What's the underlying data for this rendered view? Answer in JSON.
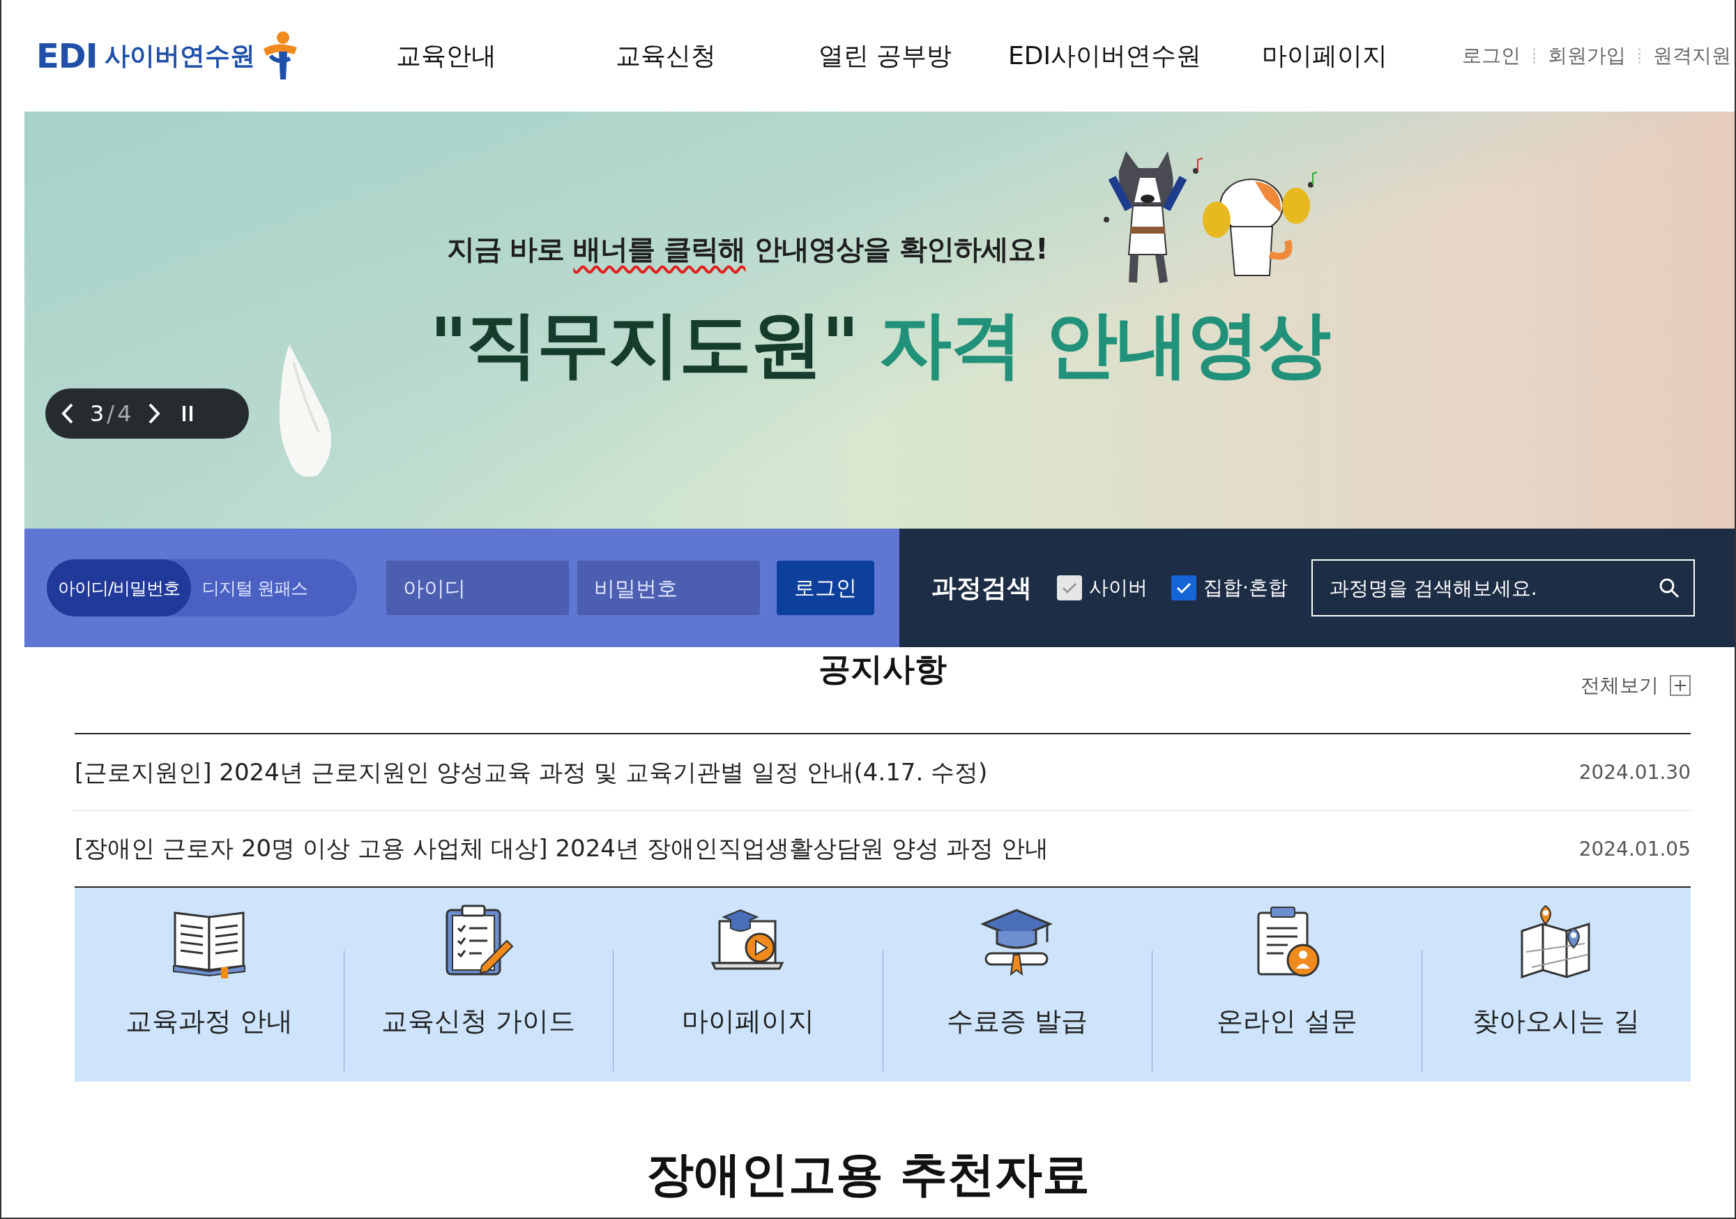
{
  "header": {
    "logo": {
      "mark": "EDI",
      "text": "사이버연수원"
    },
    "nav": [
      "교육안내",
      "교육신청",
      "열린 공부방",
      "EDI사이버연수원",
      "마이페이지"
    ],
    "util_links": [
      "로그인",
      "회원가입",
      "원격지원"
    ]
  },
  "banner": {
    "subtitle_parts": [
      {
        "text": "지금 바로 ",
        "underline": false
      },
      {
        "text": "배너를 클릭해",
        "underline": true
      },
      {
        "text": " 안내영상을 확인하세요!",
        "underline": false
      }
    ],
    "title_quote": "\"직무지도원\"",
    "title_highlight": "자격 안내영상",
    "slider": {
      "current": "3",
      "separator": "/",
      "total": "4"
    }
  },
  "login": {
    "tabs": [
      {
        "label": "아이디/비밀번호",
        "selected": true
      },
      {
        "label": "디지털 원패스",
        "selected": false
      }
    ],
    "id_placeholder": "아이디",
    "password_placeholder": "비밀번호",
    "button": "로그인"
  },
  "course_search": {
    "title": "과정검색",
    "options": [
      {
        "label": "사이버",
        "checked": true,
        "disabled": true
      },
      {
        "label": "집합·혼합",
        "checked": true,
        "disabled": false
      }
    ],
    "placeholder": "과정명을 검색해보세요."
  },
  "notices": {
    "title": "공지사항",
    "more": "전체보기",
    "items": [
      {
        "title": "[근로지원인] 2024년 근로지원인 양성교육 과정 및 교육기관별 일정 안내(4.17. 수정)",
        "date": "2024.01.30"
      },
      {
        "title": "[장애인 근로자 20명 이상 고용 사업체 대상] 2024년 장애인직업생활상담원 양성 과정 안내",
        "date": "2024.01.05"
      }
    ]
  },
  "quick_links": [
    {
      "kind": "book",
      "label": "교육과정 안내"
    },
    {
      "kind": "clipboard",
      "label": "교육신청 가이드"
    },
    {
      "kind": "laptop",
      "label": "마이페이지"
    },
    {
      "kind": "cap",
      "label": "수료증 발급"
    },
    {
      "kind": "survey",
      "label": "온라인 설문"
    },
    {
      "kind": "map",
      "label": "찾아오시는 길"
    }
  ],
  "section_title": "장애인고용 **추천자료**"
}
